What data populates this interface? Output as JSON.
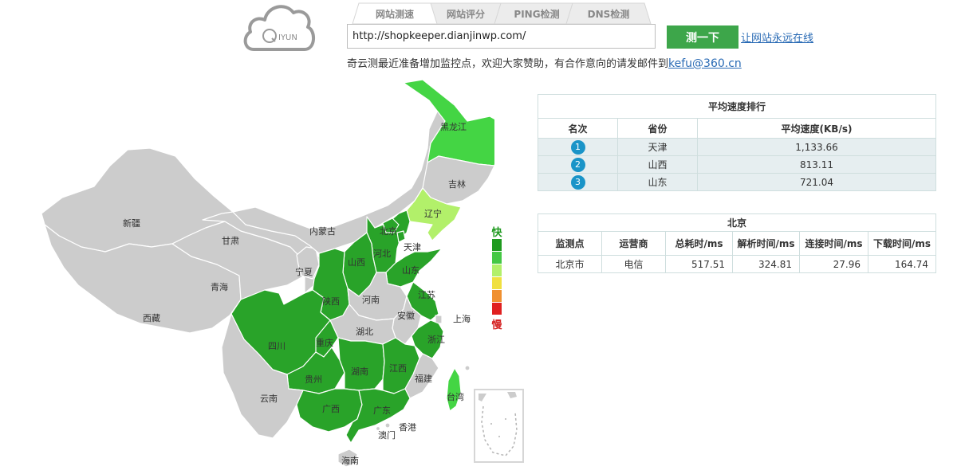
{
  "logo": {
    "text": "IYUN"
  },
  "tabs": [
    {
      "label": "网站测速",
      "active": true
    },
    {
      "label": "网站评分",
      "active": false
    },
    {
      "label": "PING检测",
      "active": false
    },
    {
      "label": "DNS检测",
      "active": false
    }
  ],
  "search": {
    "value": "http://shopkeeper.dianjinwp.com/",
    "button_label": "测一下",
    "link_label": "让网站永远在线"
  },
  "notice": {
    "text": "奇云测最近准备增加监控点，欢迎大家赞助，有合作意向的请发邮件到",
    "email": "kefu@360.cn"
  },
  "map": {
    "colors": {
      "gray": "#cccccc",
      "dark_green": "#29a329",
      "bright_green": "#44d544",
      "light_green": "#b2f06a"
    },
    "labels": {
      "heilongjiang": "黑龙江",
      "jilin": "吉林",
      "liaoning": "辽宁",
      "neimenggu": "内蒙古",
      "xinjiang": "新疆",
      "gansu": "甘肃",
      "qinghai": "青海",
      "xizang": "西藏",
      "ningxia": "宁夏",
      "shaanxi": "陕西",
      "shanxi": "山西",
      "hebei": "河北",
      "beijing": "北京",
      "tianjin": "天津",
      "shandong": "山东",
      "henan": "河南",
      "jiangsu": "江苏",
      "anhui": "安徽",
      "shanghai": "上海",
      "hubei": "湖北",
      "sichuan": "四川",
      "chongqing": "重庆",
      "zhejiang": "浙江",
      "hunan": "湖南",
      "jiangxi": "江西",
      "guizhou": "贵州",
      "fujian": "福建",
      "yunnan": "云南",
      "guangxi": "广西",
      "guangdong": "广东",
      "taiwan": "台湾",
      "xianggang": "香港",
      "aomen": "澳门",
      "hainan": "海南"
    }
  },
  "legend": {
    "fast_label": "快",
    "slow_label": "慢",
    "colors": [
      "#1f9a1f",
      "#44c844",
      "#b2f06a",
      "#f0e040",
      "#f09030",
      "#e02020"
    ]
  },
  "rank_table": {
    "title": "平均速度排行",
    "headers": [
      "名次",
      "省份",
      "平均速度(KB/s)"
    ],
    "rows": [
      {
        "rank": "1",
        "province": "天津",
        "speed": "1,133.66"
      },
      {
        "rank": "2",
        "province": "山西",
        "speed": "813.11"
      },
      {
        "rank": "3",
        "province": "山东",
        "speed": "721.04"
      }
    ]
  },
  "city_table": {
    "title": "北京",
    "headers": [
      "监测点",
      "运营商",
      "总耗时/ms",
      "解析时间/ms",
      "连接时间/ms",
      "下载时间/ms"
    ],
    "rows": [
      {
        "point": "北京市",
        "isp": "电信",
        "total": "517.51",
        "dns": "324.81",
        "connect": "27.96",
        "download": "164.74"
      }
    ]
  }
}
